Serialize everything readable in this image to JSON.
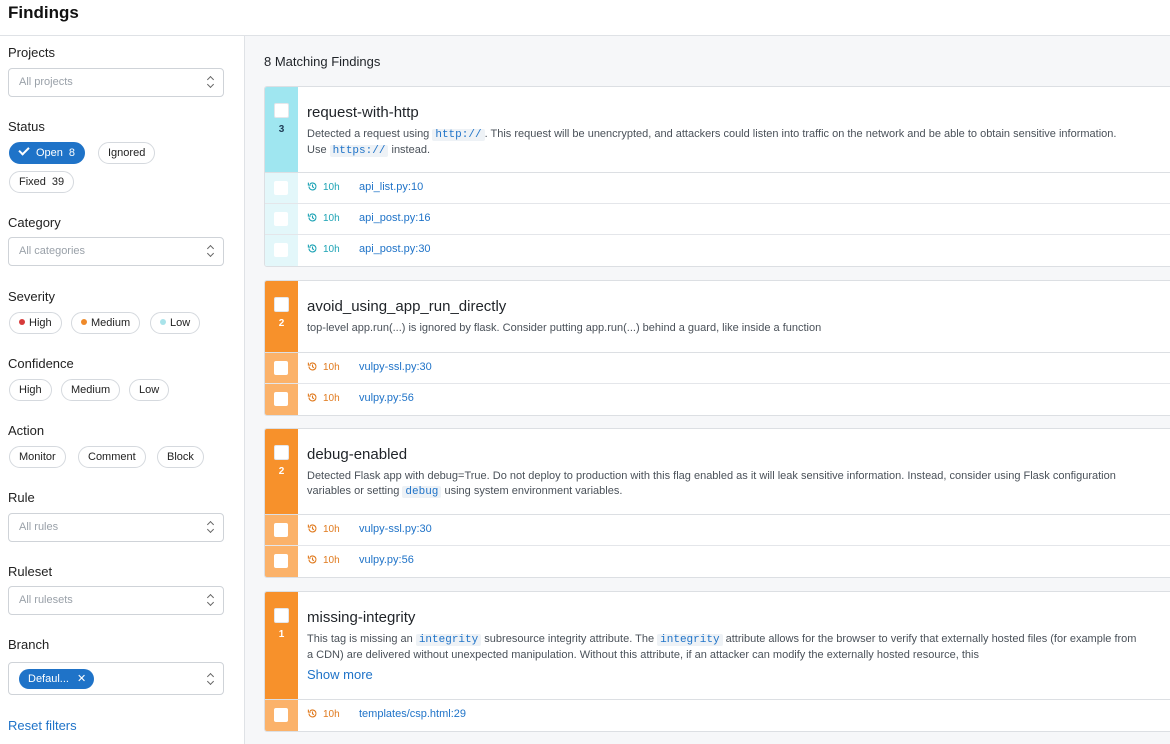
{
  "header": {
    "title": "Findings"
  },
  "filters": {
    "projects": {
      "label": "Projects",
      "placeholder": "All projects"
    },
    "status": {
      "label": "Status",
      "open_label": "Open",
      "open_count": "8",
      "ignored_label": "Ignored",
      "fixed_label": "Fixed",
      "fixed_count": "39"
    },
    "category": {
      "label": "Category",
      "placeholder": "All categories"
    },
    "severity": {
      "label": "Severity",
      "high": "High",
      "medium": "Medium",
      "low": "Low",
      "colors": {
        "high": "#d63a3a",
        "medium": "#ef8a2a",
        "low": "#a9e3ea"
      }
    },
    "confidence": {
      "label": "Confidence",
      "high": "High",
      "medium": "Medium",
      "low": "Low"
    },
    "action": {
      "label": "Action",
      "monitor": "Monitor",
      "comment": "Comment",
      "block": "Block"
    },
    "rule": {
      "label": "Rule",
      "placeholder": "All rules"
    },
    "ruleset": {
      "label": "Ruleset",
      "placeholder": "All rulesets"
    },
    "branch": {
      "label": "Branch",
      "selected": "Defaul..."
    },
    "reset_label": "Reset filters"
  },
  "main": {
    "count_title": "8 Matching Findings",
    "findings": [
      {
        "rule": "request-with-http",
        "count": "3",
        "desc_parts": [
          "Detected a request using ",
          "http://",
          ". This request will be unencrypted, and attackers could listen into traffic on the network and be able to obtain sensitive information. Use ",
          "https://",
          " instead."
        ],
        "locations": [
          {
            "age": "10h",
            "file": "api_list.py:10"
          },
          {
            "age": "10h",
            "file": "api_post.py:16"
          },
          {
            "age": "10h",
            "file": "api_post.py:30"
          }
        ]
      },
      {
        "rule": "avoid_using_app_run_directly",
        "count": "2",
        "desc": "top-level app.run(...) is ignored by flask. Consider putting app.run(...) behind a guard, like inside a function",
        "locations": [
          {
            "age": "10h",
            "file": "vulpy-ssl.py:30"
          },
          {
            "age": "10h",
            "file": "vulpy.py:56"
          }
        ]
      },
      {
        "rule": "debug-enabled",
        "count": "2",
        "desc_parts": [
          "Detected Flask app with debug=True. Do not deploy to production with this flag enabled as it will leak sensitive information. Instead, consider using Flask configuration variables or setting ",
          "debug",
          " using system environment variables."
        ],
        "locations": [
          {
            "age": "10h",
            "file": "vulpy-ssl.py:30"
          },
          {
            "age": "10h",
            "file": "vulpy.py:56"
          }
        ]
      },
      {
        "rule": "missing-integrity",
        "count": "1",
        "desc_parts": [
          "This tag is missing an ",
          "integrity",
          " subresource integrity attribute. The ",
          "integrity",
          " attribute allows for the browser to verify that externally hosted files (for example from a CDN) are delivered without unexpected manipulation. Without this attribute, if an attacker can modify the externally hosted resource, this"
        ],
        "show_more": "Show more",
        "locations": [
          {
            "age": "10h",
            "file": "templates/csp.html:29"
          }
        ]
      }
    ]
  }
}
